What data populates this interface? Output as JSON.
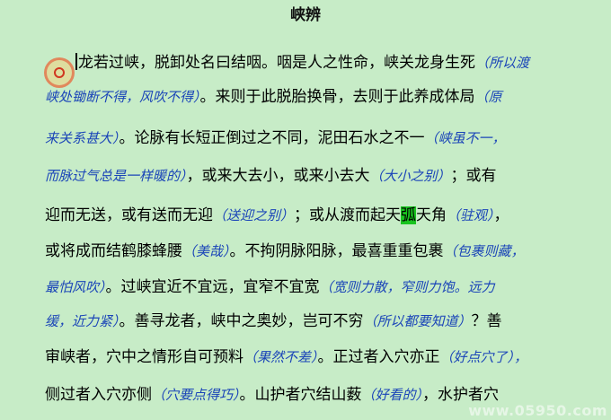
{
  "title": "峡辨",
  "lines": [
    [
      [
        "t",
        "龙若过峡，脱卸处名曰结咽。咽是人之性命，峡关龙身生死"
      ],
      [
        "n",
        "（所以渡"
      ]
    ],
    [
      [
        "n",
        "峡处锄断不得，风吹不得）"
      ],
      [
        "t",
        "。来则于此脱胎换骨，去则于此养成体局"
      ],
      [
        "n",
        "（原"
      ]
    ],
    [
      [
        "n",
        "来关系甚大）"
      ],
      [
        "t",
        "。论脉有长短正倒过之不同，泥田石水之不一"
      ],
      [
        "n",
        "（峡虽不一，"
      ]
    ],
    [
      [
        "n",
        "而脉过气总是一样暖的）"
      ],
      [
        "t",
        "，或来大去小，或来小去大"
      ],
      [
        "n",
        "（大小之别）"
      ],
      [
        "t",
        "；或有"
      ]
    ],
    [
      [
        "t",
        "迎而无送，或有送而无迎"
      ],
      [
        "n",
        "（送迎之别）"
      ],
      [
        "t",
        "；或从渡而起天"
      ],
      [
        "h",
        "弧"
      ],
      [
        "t",
        "天角"
      ],
      [
        "n",
        "（驻观）"
      ],
      [
        "t",
        "，"
      ]
    ],
    [
      [
        "t",
        "或将成而结鹤膝蜂腰"
      ],
      [
        "n",
        "（美哉）"
      ],
      [
        "t",
        "。不拘阴脉阳脉，最喜重重包裹"
      ],
      [
        "n",
        "（包裹则藏，"
      ]
    ],
    [
      [
        "n",
        "最怕风吹）"
      ],
      [
        "t",
        "。过峡宜近不宜远，宜窄不宜宽"
      ],
      [
        "n",
        "（宽则力散，窄则力饱。远力"
      ]
    ],
    [
      [
        "n",
        "缓，近力紧）"
      ],
      [
        "t",
        "。善寻龙者，峡中之奥妙，岂可不穷"
      ],
      [
        "n",
        "（所以都要知道）"
      ],
      [
        "t",
        "？善"
      ]
    ],
    [
      [
        "t",
        "审峡者，穴中之情形自可预料"
      ],
      [
        "n",
        "（果然不差）"
      ],
      [
        "t",
        "。正过者入穴亦正"
      ],
      [
        "n",
        "（好点穴了），"
      ]
    ],
    [
      [
        "t",
        "侧过者入穴亦侧"
      ],
      [
        "n",
        "（穴要点得巧）"
      ],
      [
        "t",
        "。山护者穴结山薮"
      ],
      [
        "n",
        "（好看的）"
      ],
      [
        "t",
        "，水护者穴"
      ]
    ]
  ],
  "watermark": "www.05950.com",
  "colors": {
    "background": "#c7ecc7",
    "note": "#1a44b8",
    "highlight": "#19c41f"
  }
}
